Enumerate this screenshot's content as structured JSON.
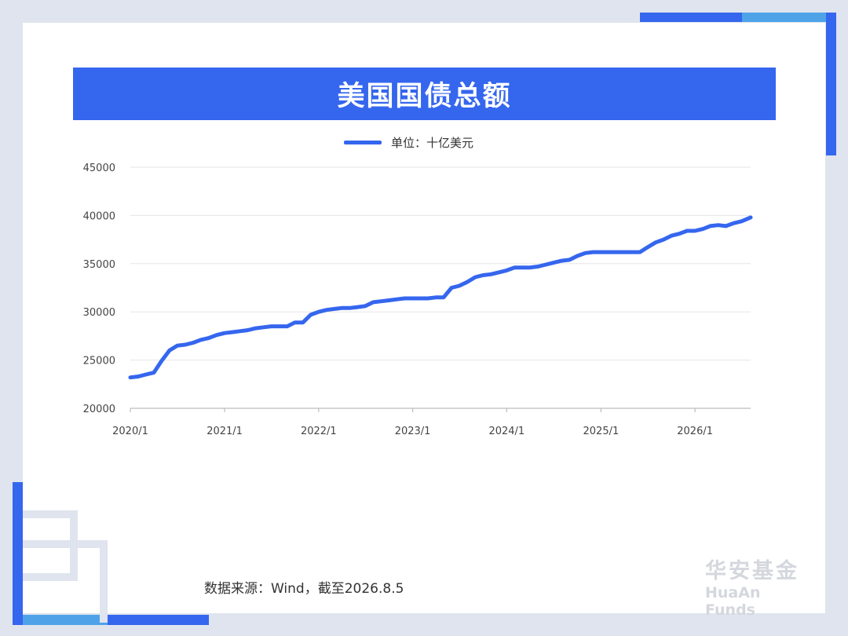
{
  "title": "美国国债总额",
  "legend": {
    "label": "单位：十亿美元"
  },
  "source": "数据来源：Wind，截至2026.8.5",
  "brand": {
    "cn": "华安基金",
    "en": "HuaAn Funds"
  },
  "colors": {
    "accent": "#3566ee",
    "frame": "#dfe4ee",
    "brand_text": "#d4d7dd"
  },
  "chart_data": {
    "type": "line",
    "title": "美国国债总额",
    "xlabel": "",
    "ylabel": "",
    "ylim": [
      20000,
      45000
    ],
    "xlim": [
      "2020-01-01",
      "2026-08-05"
    ],
    "y_ticks": [
      "20000",
      "25000",
      "30000",
      "35000",
      "40000",
      "45000"
    ],
    "x_ticks": [
      "2020/1",
      "2021/1",
      "2022/1",
      "2023/1",
      "2024/1",
      "2025/1",
      "2026/1"
    ],
    "grid": true,
    "legend_position": "top-center",
    "series": [
      {
        "name": "单位：十亿美元",
        "color": "#3566ee",
        "x": [
          "2020-01-01",
          "2020-02-01",
          "2020-03-01",
          "2020-04-01",
          "2020-05-01",
          "2020-06-01",
          "2020-07-01",
          "2020-08-01",
          "2020-09-01",
          "2020-10-01",
          "2020-11-01",
          "2020-12-01",
          "2021-01-01",
          "2021-02-01",
          "2021-03-01",
          "2021-04-01",
          "2021-05-01",
          "2021-06-01",
          "2021-07-01",
          "2021-08-01",
          "2021-09-01",
          "2021-10-01",
          "2021-11-01",
          "2021-12-01",
          "2022-01-01",
          "2022-02-01",
          "2022-03-01",
          "2022-04-01",
          "2022-05-01",
          "2022-06-01",
          "2022-07-01",
          "2022-08-01",
          "2022-09-01",
          "2022-10-01",
          "2022-11-01",
          "2022-12-01",
          "2023-01-01",
          "2023-02-01",
          "2023-03-01",
          "2023-04-01",
          "2023-05-01",
          "2023-06-01",
          "2023-07-01",
          "2023-08-01",
          "2023-09-01",
          "2023-10-01",
          "2023-11-01",
          "2023-12-01",
          "2024-01-01",
          "2024-02-01",
          "2024-03-01",
          "2024-04-01",
          "2024-05-01",
          "2024-06-01",
          "2024-07-01",
          "2024-08-01",
          "2024-09-01",
          "2024-10-01",
          "2024-11-01",
          "2024-12-01",
          "2025-01-01",
          "2025-02-01",
          "2025-03-01",
          "2025-04-01",
          "2025-05-01",
          "2025-06-01",
          "2025-07-01",
          "2025-08-01",
          "2025-09-01",
          "2025-10-01",
          "2025-11-01",
          "2025-12-01",
          "2026-01-01",
          "2026-02-01",
          "2026-03-01",
          "2026-04-01",
          "2026-05-01",
          "2026-06-01",
          "2026-07-01",
          "2026-08-05"
        ],
        "values": [
          23200,
          23300,
          23500,
          23700,
          24900,
          26000,
          26500,
          26600,
          26800,
          27100,
          27300,
          27600,
          27800,
          27900,
          28000,
          28100,
          28300,
          28400,
          28500,
          28500,
          28500,
          28900,
          28900,
          29700,
          30000,
          30200,
          30300,
          30400,
          30400,
          30500,
          30600,
          31000,
          31100,
          31200,
          31300,
          31400,
          31400,
          31400,
          31400,
          31500,
          31500,
          32500,
          32700,
          33100,
          33600,
          33800,
          33900,
          34100,
          34300,
          34600,
          34600,
          34600,
          34700,
          34900,
          35100,
          35300,
          35400,
          35800,
          36100,
          36200,
          36200,
          36200,
          36200,
          36200,
          36200,
          36200,
          36700,
          37200,
          37500,
          37900,
          38100,
          38400,
          38400,
          38600,
          38900,
          39000,
          38900,
          39200,
          39400,
          39800
        ]
      }
    ]
  }
}
